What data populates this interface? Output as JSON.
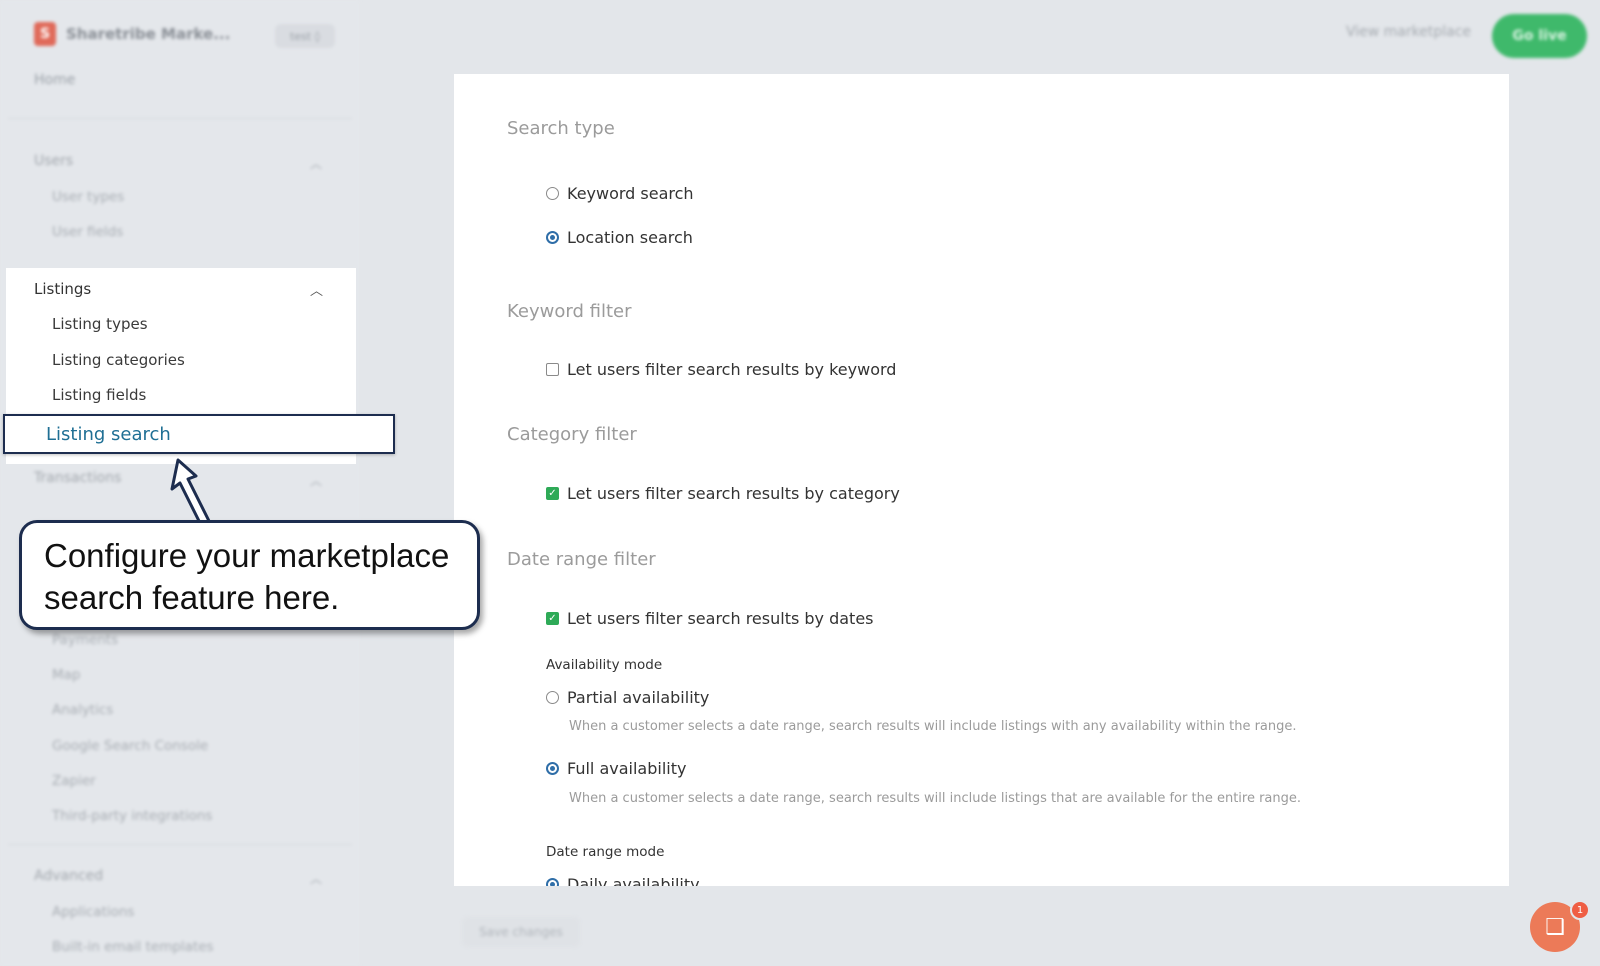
{
  "app": {
    "brand_letter": "S",
    "brand_name": "Sharetribe Marke...",
    "env_badge": "test",
    "home": "Home",
    "view_marketplace": "View marketplace",
    "go_live": "Go live"
  },
  "sidebar": {
    "users": {
      "label": "Users",
      "items": [
        "User types",
        "User fields"
      ]
    },
    "listings": {
      "label": "Listings",
      "items": [
        "Listing types",
        "Listing categories",
        "Listing fields",
        "Listing search"
      ]
    },
    "transactions": {
      "label": "Transactions"
    },
    "integrations_items": [
      "Payments",
      "Map",
      "Analytics",
      "Google Search Console",
      "Zapier",
      "Third-party integrations"
    ],
    "advanced": {
      "label": "Advanced",
      "items": [
        "Applications",
        "Built-in email templates"
      ]
    }
  },
  "main": {
    "search_type": {
      "title": "Search type",
      "options": [
        "Keyword search",
        "Location search"
      ],
      "selected": "Location search"
    },
    "keyword_filter": {
      "title": "Keyword filter",
      "checkbox": "Let users filter search results by keyword",
      "checked": false
    },
    "category_filter": {
      "title": "Category filter",
      "checkbox": "Let users filter search results by category",
      "checked": true
    },
    "date_range_filter": {
      "title": "Date range filter",
      "checkbox": "Let users filter search results by dates",
      "checked": true,
      "availability_mode_label": "Availability mode",
      "partial": {
        "label": "Partial availability",
        "help": "When a customer selects a date range, search results will include listings with any availability within the range."
      },
      "full": {
        "label": "Full availability",
        "help": "When a customer selects a date range, search results will include listings that are available for the entire range."
      },
      "selected": "Full availability",
      "date_range_mode_label": "Date range mode",
      "next_option_partial": "Daily availability"
    }
  },
  "footer": {
    "save_label": "Save changes"
  },
  "chat": {
    "count": "1"
  },
  "callout": {
    "text": "Configure your marketplace search feature here."
  },
  "colors": {
    "accent": "#2f6ea8",
    "check_green": "#2eaa57",
    "go_live_green": "#3fb96b",
    "callout_border": "#1d2d4f",
    "active_link": "#1f6f94"
  }
}
